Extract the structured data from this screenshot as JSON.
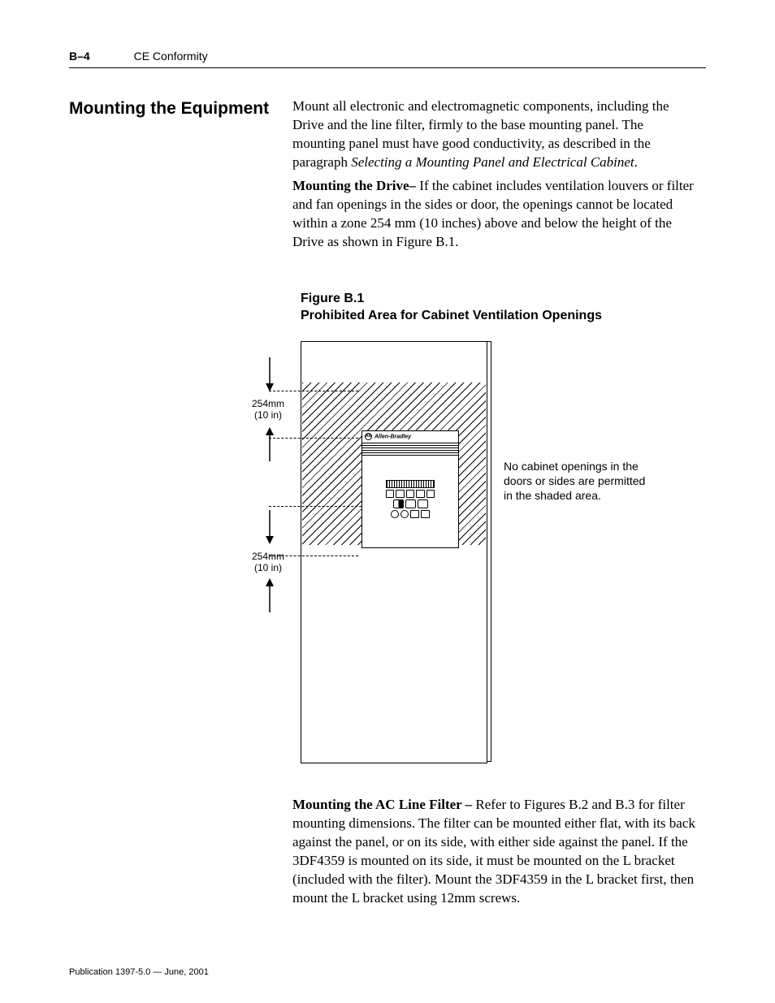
{
  "header": {
    "page_number": "B–4",
    "section": "CE Conformity"
  },
  "section_heading": "Mounting the Equipment",
  "paragraphs": {
    "p1_a": "Mount all electronic and electromagnetic components, including the Drive and the line filter, firmly to the base mounting panel.  The mounting panel must have good conductivity, as described in the paragraph ",
    "p1_italic": "Selecting a Mounting Panel and Electrical Cabinet",
    "p1_b": ".",
    "p2_bold": "Mounting the Drive– ",
    "p2_a": " If the cabinet includes ventilation louvers or filter and fan openings in the sides or door, the openings cannot be located within a zone 254 mm (10 inches) above and below the height of the Drive as shown in Figure B.1.",
    "p3_bold": "Mounting the AC Line Filter – ",
    "p3_a": " Refer to Figures B.2 and B.3 for filter mounting dimensions.  The filter can be mounted either flat, with its back against the panel, or on its side, with either side against the panel.  If the 3DF4359 is mounted on its side, it must be mounted on the L bracket (included with the filter).  Mount the 3DF4359 in the L bracket first, then mount the L bracket using 12mm screws."
  },
  "figure": {
    "number": "Figure B.1",
    "title": "Prohibited Area for Cabinet Ventilation Openings",
    "dim_mm": "254mm",
    "dim_in": "(10 in)",
    "note": "No cabinet openings in the doors or sides are permitted in the shaded area.",
    "drive_brand": "Allen-Bradley"
  },
  "footer": "Publication 1397-5.0  —  June, 2001"
}
